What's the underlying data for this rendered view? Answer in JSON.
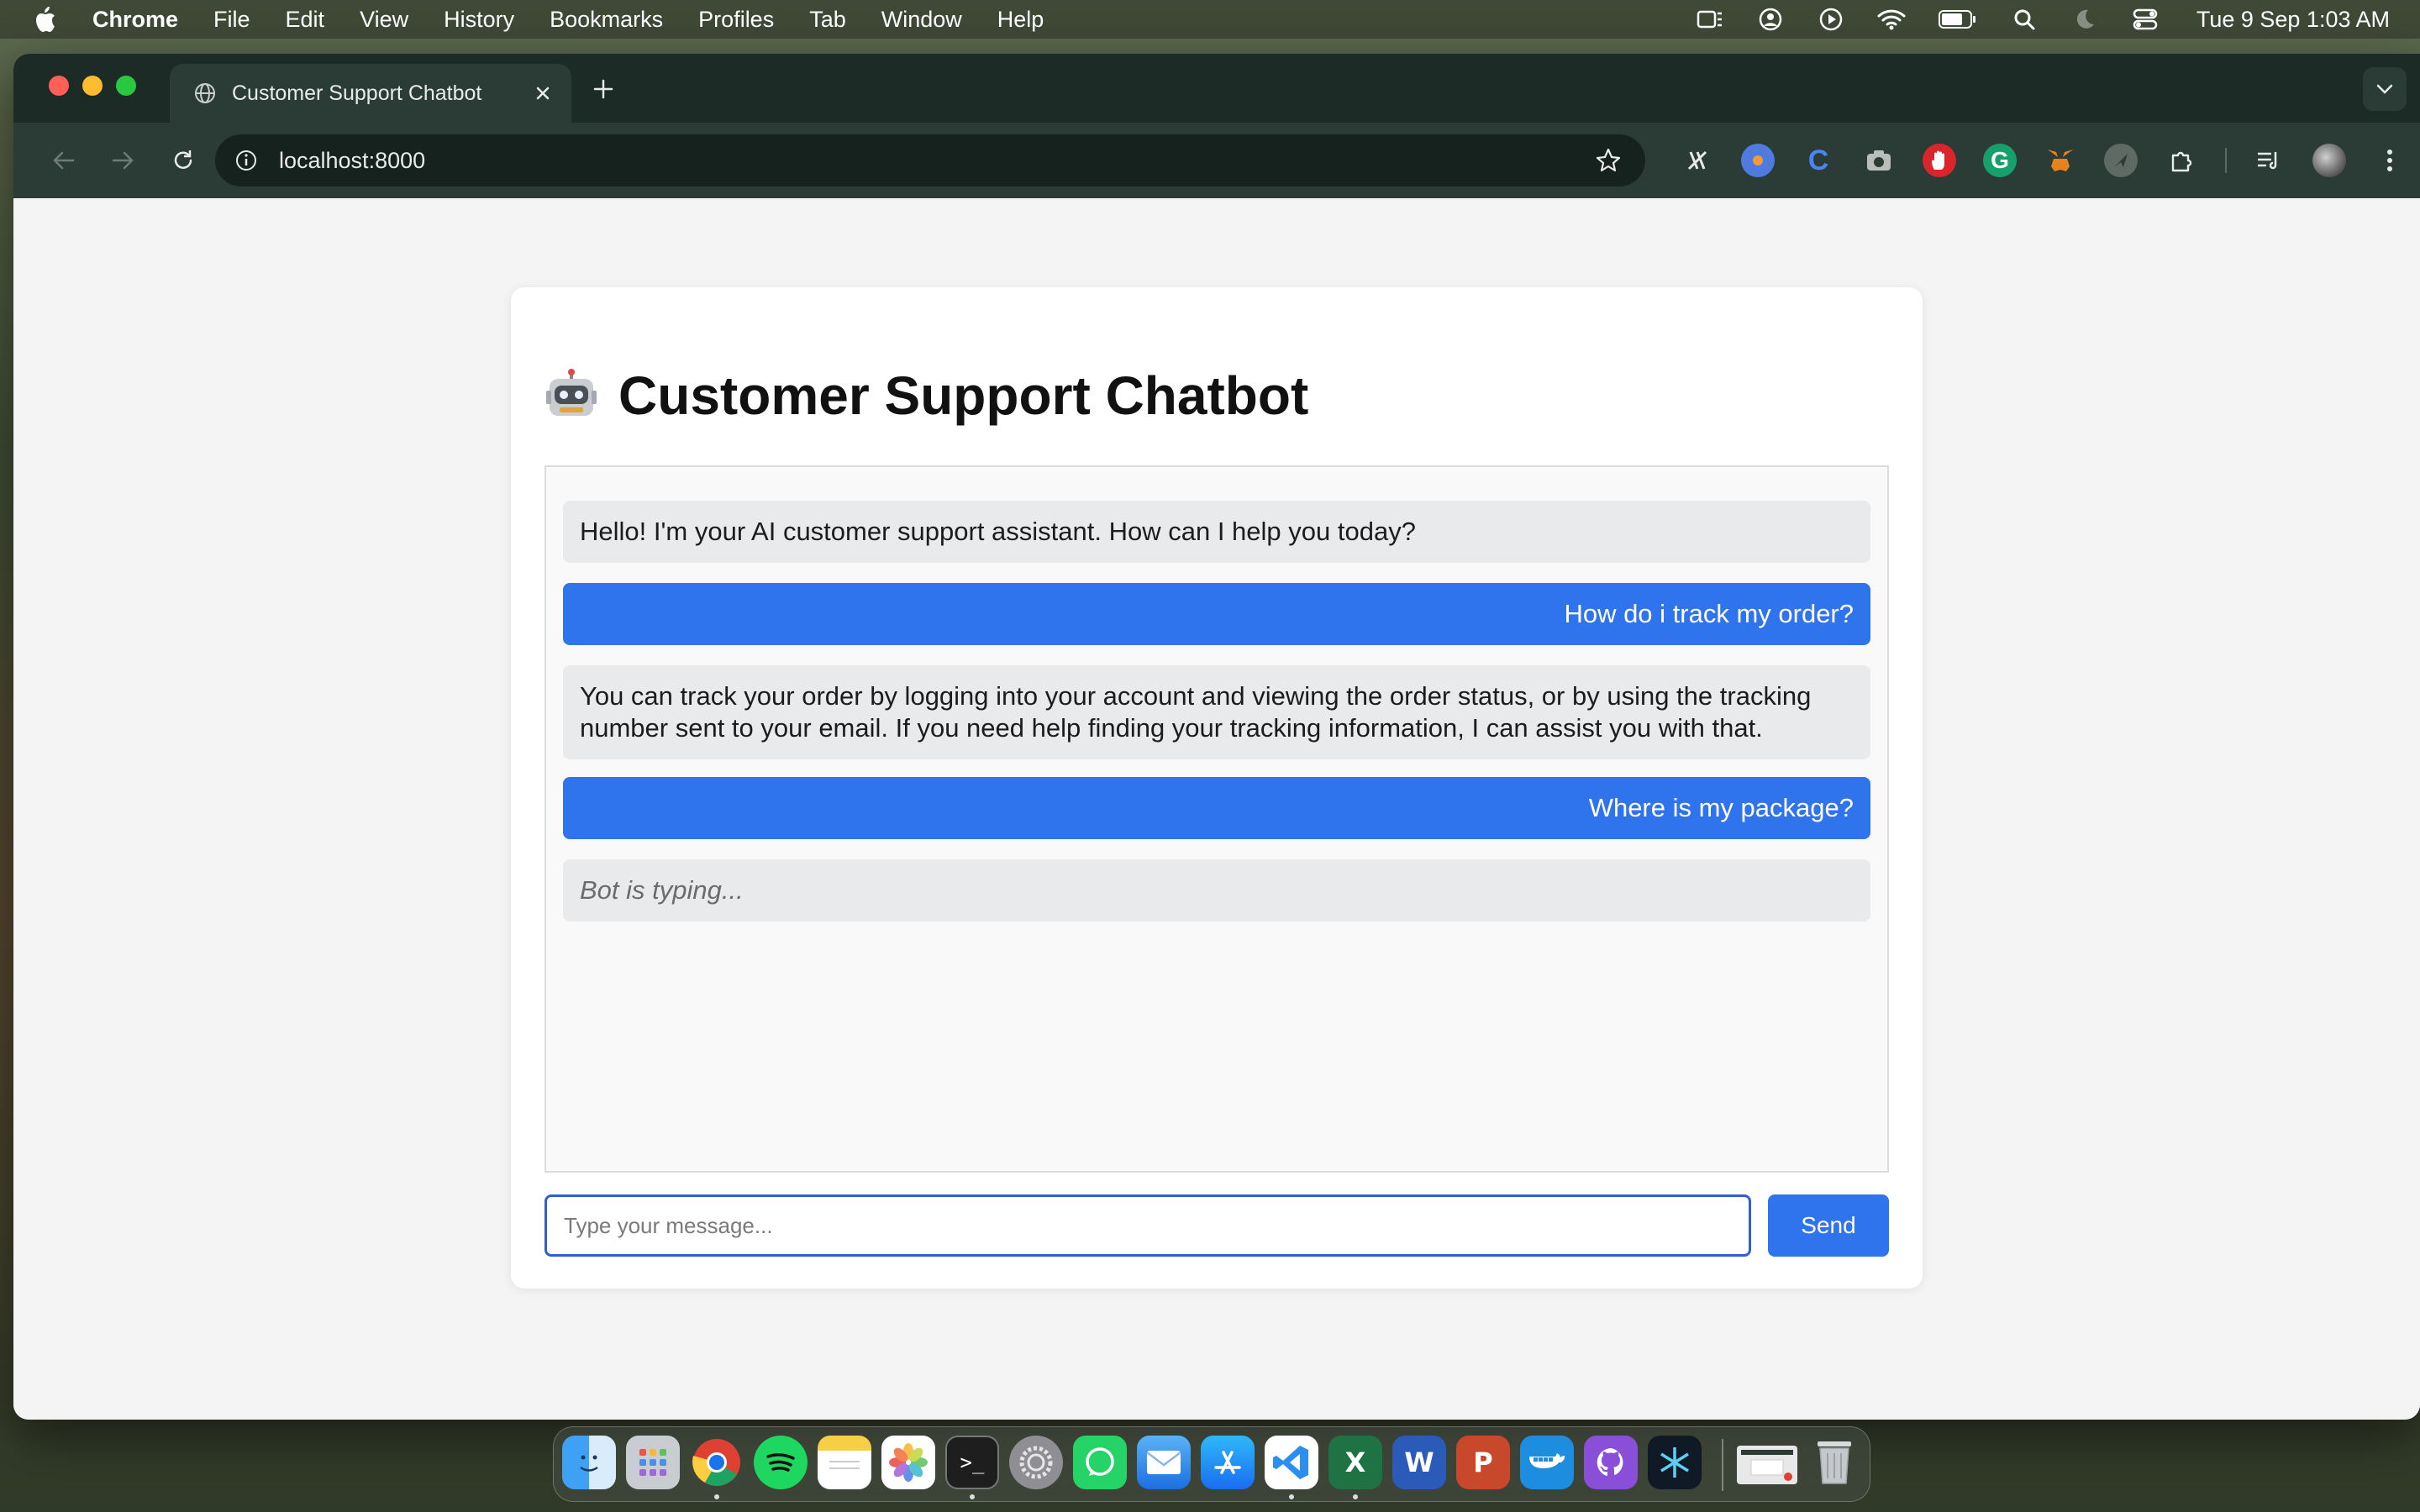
{
  "menubar": {
    "app": "Chrome",
    "items": [
      "File",
      "Edit",
      "View",
      "History",
      "Bookmarks",
      "Profiles",
      "Tab",
      "Window",
      "Help"
    ],
    "clock": "Tue 9 Sep  1:03 AM",
    "status_icons": [
      "stage-manager-icon",
      "user-account-icon",
      "play-icon",
      "wifi-icon",
      "battery-icon",
      "spotlight-search-icon",
      "focus-moon-icon",
      "control-center-icon"
    ]
  },
  "browser": {
    "tab_title": "Customer Support Chatbot",
    "url": "localhost:8000",
    "extensions": [
      "extension-1-icon",
      "extension-2-icon",
      "extension-3-icon",
      "camera-extension-icon",
      "hand-extension-icon",
      "grammarly-icon",
      "metamask-icon",
      "extension-8-icon",
      "extensions-puzzle-icon",
      "reading-list-icon",
      "profile-avatar-icon",
      "more-menu-icon"
    ]
  },
  "page": {
    "title": "Customer Support Chatbot",
    "title_icon": "robot-icon",
    "messages": [
      {
        "role": "bot",
        "text": "Hello! I'm your AI customer support assistant. How can I help you today?"
      },
      {
        "role": "user",
        "text": "How do i track my order?"
      },
      {
        "role": "bot",
        "text": "You can track your order by logging into your account and viewing the order status, or by using the tracking number sent to your email. If you need help finding your tracking information, I can assist you with that."
      },
      {
        "role": "user",
        "text": "Where is my package?"
      }
    ],
    "typing_indicator": "Bot is typing...",
    "input_placeholder": "Type your message...",
    "input_value": "",
    "send_label": "Send"
  },
  "dock": {
    "apps": [
      "finder-icon",
      "launchpad-icon",
      "chrome-icon",
      "spotify-icon",
      "notes-icon",
      "photos-icon",
      "terminal-icon",
      "system-settings-icon",
      "whatsapp-icon",
      "mail-icon",
      "app-store-icon",
      "vscode-icon",
      "excel-icon",
      "word-icon",
      "powerpoint-icon",
      "docker-icon",
      "github-desktop-icon",
      "cursor-icon",
      "chrome-window-thumbnail-icon",
      "trash-icon"
    ]
  },
  "colors": {
    "accent": "#2f74ec",
    "bot_bubble": "#e9eaec",
    "toolbar": "#2b3b35",
    "tabstrip": "#1c2b26"
  }
}
